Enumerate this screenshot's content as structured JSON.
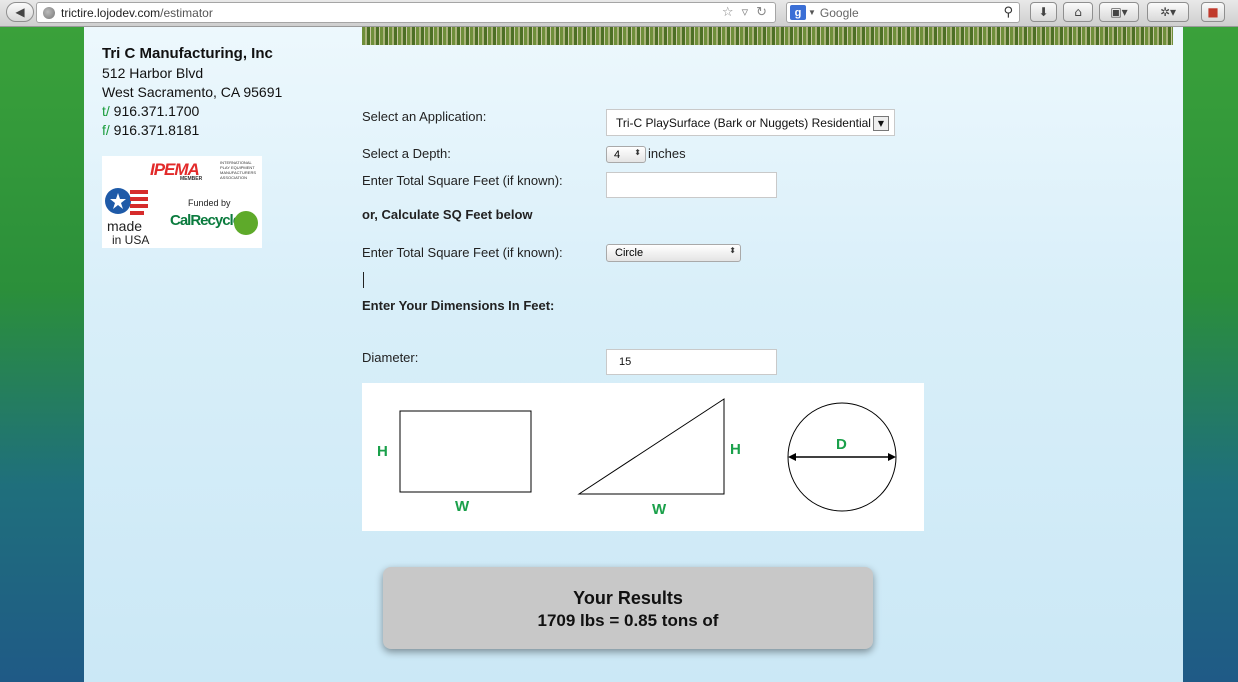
{
  "browser": {
    "url_host": "trictire.lojodev.com",
    "url_path": "/estimator",
    "search_placeholder": "Google"
  },
  "company": {
    "name": "Tri C Manufacturing, Inc",
    "address_line1": "512 Harbor Blvd",
    "address_line2": "West Sacramento, CA 95691",
    "phone_prefix": "t/",
    "phone": "916.371.1700",
    "fax_prefix": "f/",
    "fax": "916.371.8181"
  },
  "logos": {
    "ipema": "IPEMA",
    "ipema_small": "INTERNATIONAL PLAY EQUIPMENT MANUFACTURERS ASSOCIATION",
    "ipema_member": "MEMBER",
    "made": "made",
    "in_usa": "in USA",
    "funded_by": "Funded by",
    "calrecycle": "CalRecycle"
  },
  "form": {
    "application_label": "Select an Application:",
    "application_value": "Tri-C PlaySurface (Bark or Nuggets) Residential",
    "depth_label": "Select a Depth:",
    "depth_value": "4",
    "depth_unit": "inches",
    "sqft_label": "Enter Total Square Feet (if known):",
    "sqft_value": "",
    "calc_heading": "or, Calculate SQ Feet below",
    "shape_label": "Enter Total Square Feet (if known):",
    "shape_value": "Circle",
    "dimensions_heading": "Enter Your Dimensions In Feet:",
    "diameter_label": "Diameter:",
    "diameter_value": "15"
  },
  "diagram": {
    "rect_h": "H",
    "rect_w": "W",
    "tri_h": "H",
    "tri_w": "W",
    "circle_d": "D",
    "label_color": "#1aa04a"
  },
  "results": {
    "title": "Your Results",
    "value": "1709 lbs = 0.85 tons of"
  }
}
